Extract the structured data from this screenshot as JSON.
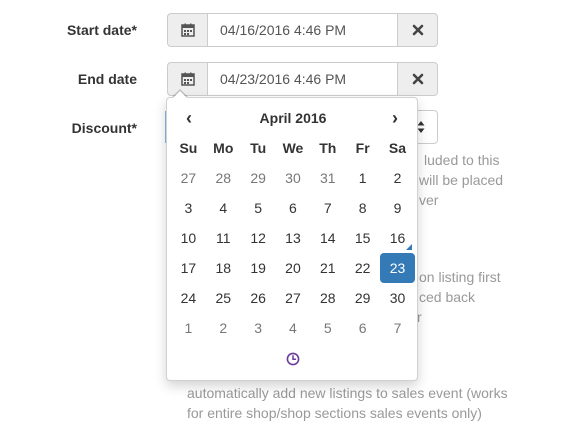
{
  "form": {
    "start_date": {
      "label": "Start date*",
      "value": "04/16/2016 4:46 PM"
    },
    "end_date": {
      "label": "End date",
      "value": "04/23/2016 4:46 PM"
    },
    "discount": {
      "label": "Discount*"
    }
  },
  "icons": {
    "calendar": "calendar-icon",
    "remove": "times-icon",
    "select": "sort-arrows-icon",
    "clock": "clock-icon",
    "prev": "chevron-left-icon",
    "next": "chevron-right-icon"
  },
  "help_fragments": {
    "l1": "luded to this",
    "l2": "will be placed",
    "l3": "ver",
    "l4": "on listing first",
    "l5": "ced back",
    "l6": "r",
    "bottom1": "automatically add new listings to sales event (works",
    "bottom2": "for entire shop/shop sections sales events only)"
  },
  "datepicker": {
    "month_title": "April 2016",
    "prev_label": "‹",
    "next_label": "›",
    "weekdays": [
      "Su",
      "Mo",
      "Tu",
      "We",
      "Th",
      "Fr",
      "Sa"
    ],
    "weeks": [
      [
        "27",
        "28",
        "29",
        "30",
        "31",
        "1",
        "2"
      ],
      [
        "3",
        "4",
        "5",
        "6",
        "7",
        "8",
        "9"
      ],
      [
        "10",
        "11",
        "12",
        "13",
        "14",
        "15",
        "16"
      ],
      [
        "17",
        "18",
        "19",
        "20",
        "21",
        "22",
        "23"
      ],
      [
        "24",
        "25",
        "26",
        "27",
        "28",
        "29",
        "30"
      ],
      [
        "1",
        "2",
        "3",
        "4",
        "5",
        "6",
        "7"
      ]
    ],
    "selected_day": "23",
    "today_day": "16",
    "accent_color": "#337ab7",
    "clock_color": "#6a3d9a"
  }
}
